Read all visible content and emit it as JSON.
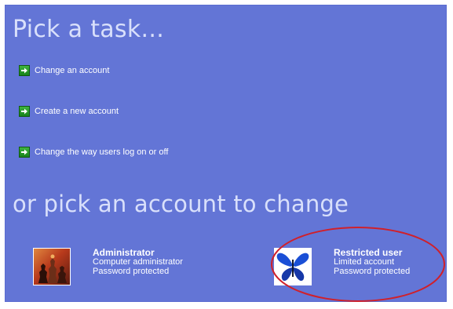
{
  "headings": {
    "pick_task": "Pick a task...",
    "pick_account": "or pick an account to change"
  },
  "tasks": [
    {
      "label": "Change an account",
      "icon": "green-arrow-icon"
    },
    {
      "label": "Create a new account",
      "icon": "green-arrow-icon"
    },
    {
      "label": "Change the way users log on or off",
      "icon": "green-arrow-icon"
    }
  ],
  "accounts": [
    {
      "name": "Administrator",
      "type": "Computer administrator",
      "status": "Password protected",
      "picture": "chess-pieces-picture"
    },
    {
      "name": "Restricted user",
      "type": "Limited account",
      "status": "Password protected",
      "picture": "blue-butterfly-picture"
    }
  ],
  "colors": {
    "panel_background": "#6375d6",
    "heading_text": "#d9e0fb",
    "task_icon": "#16821a",
    "highlight_ring": "#d0202a"
  }
}
